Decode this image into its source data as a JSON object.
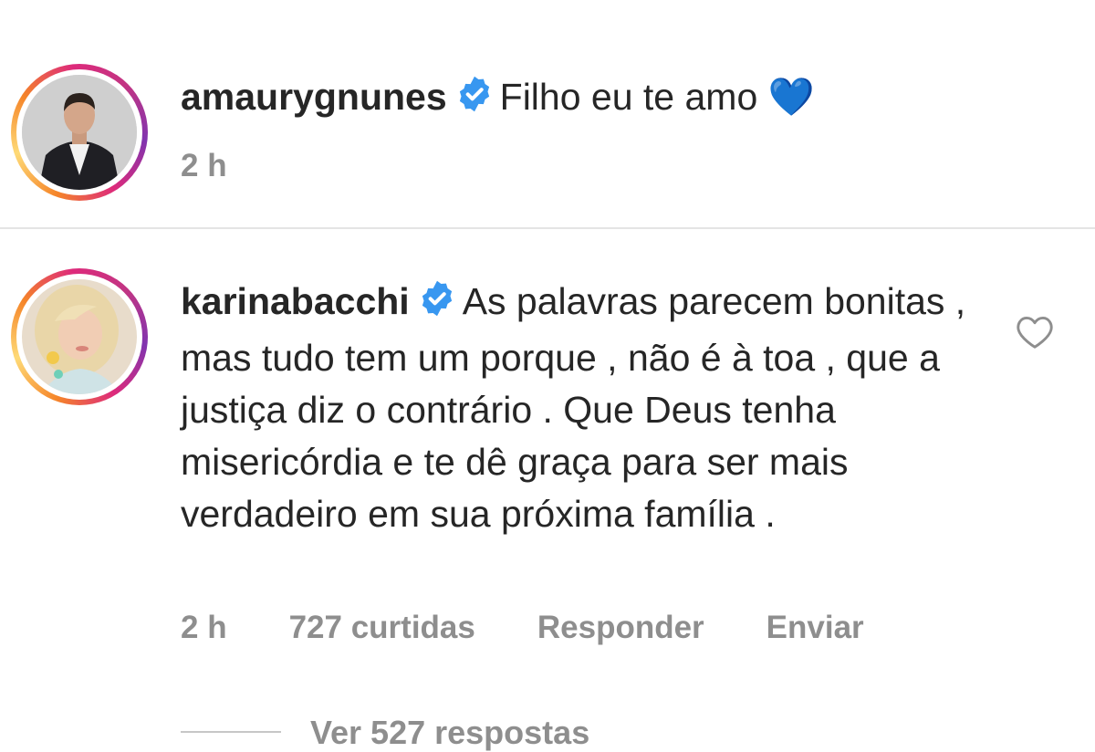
{
  "comments": [
    {
      "username": "amaurygnunes",
      "text": "Filho eu te amo",
      "emoji": "💙",
      "time": "2 h",
      "verified": true
    },
    {
      "username": "karinabacchi",
      "text": "As palavras parecem bonitas , mas tudo tem um porque , não é à toa , que a justiça diz o contrário . Que Deus tenha misericórdia e te dê graça para ser mais verdadeiro em sua próxima família .",
      "time": "2 h",
      "likes": "727 curtidas",
      "reply_label": "Responder",
      "send_label": "Enviar",
      "verified": true
    }
  ],
  "view_more": "Ver 527 respostas",
  "colors": {
    "verified_badge": "#3897f0",
    "meta_text": "#8e8e8e",
    "heart_outline": "#8e8e8e"
  },
  "icons": {
    "verified": "verified-badge-icon",
    "like": "heart-outline-icon"
  }
}
